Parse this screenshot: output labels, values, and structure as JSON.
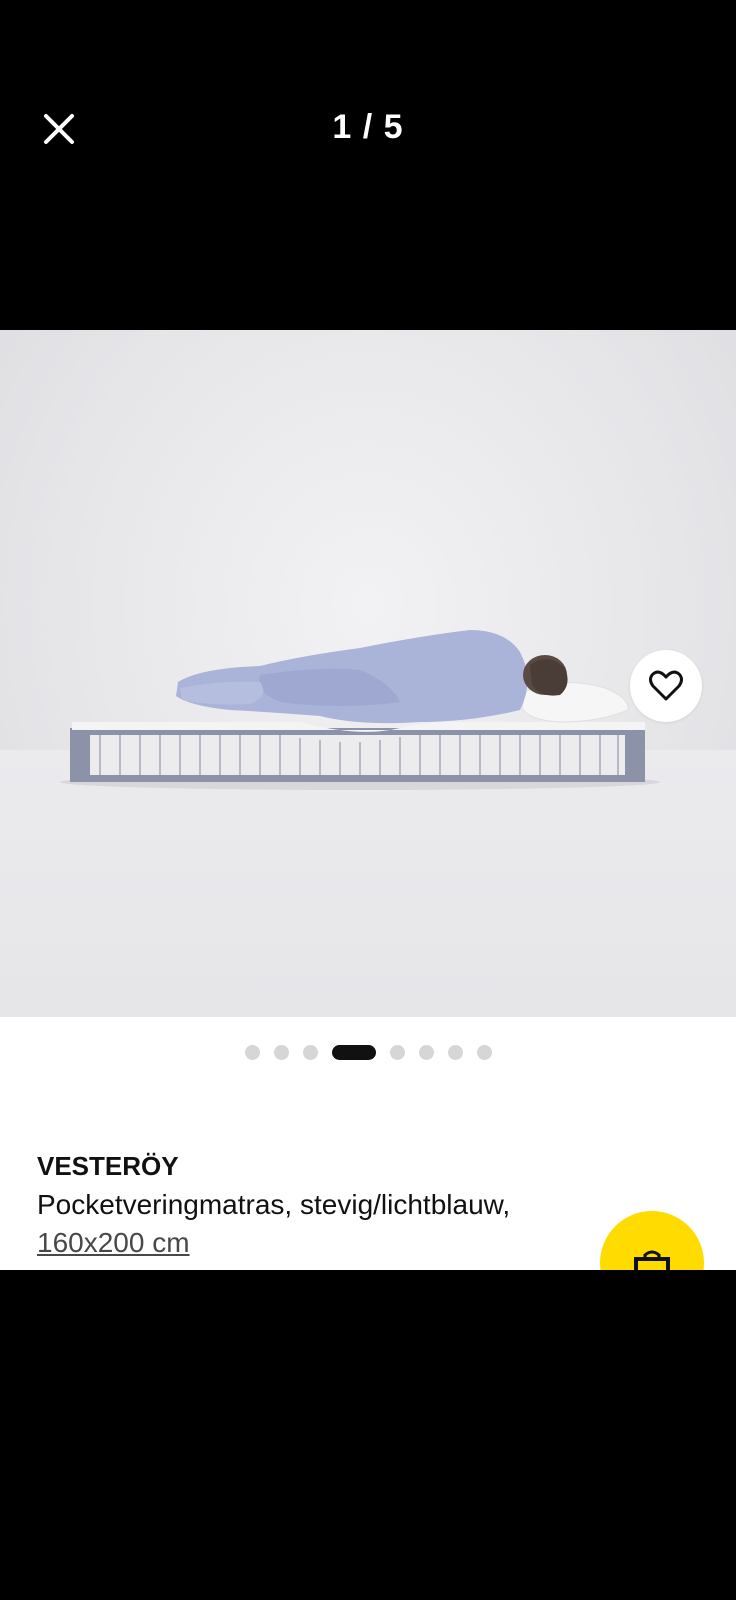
{
  "header": {
    "counter": "1 / 5",
    "close_icon": "close-icon"
  },
  "gallery": {
    "favorite_icon": "heart-icon",
    "slide_count": 8,
    "active_slide": 4
  },
  "product": {
    "name": "VESTERÖY",
    "description": "Pocketveringmatras, stevig/lichtblauw,",
    "size": "160x200 cm"
  },
  "actions": {
    "cart_icon": "shopping-bag-icon"
  },
  "colors": {
    "accent": "#ffdb00",
    "background": "#000000",
    "dot_active": "#111111",
    "dot_inactive": "#d6d6d6"
  }
}
